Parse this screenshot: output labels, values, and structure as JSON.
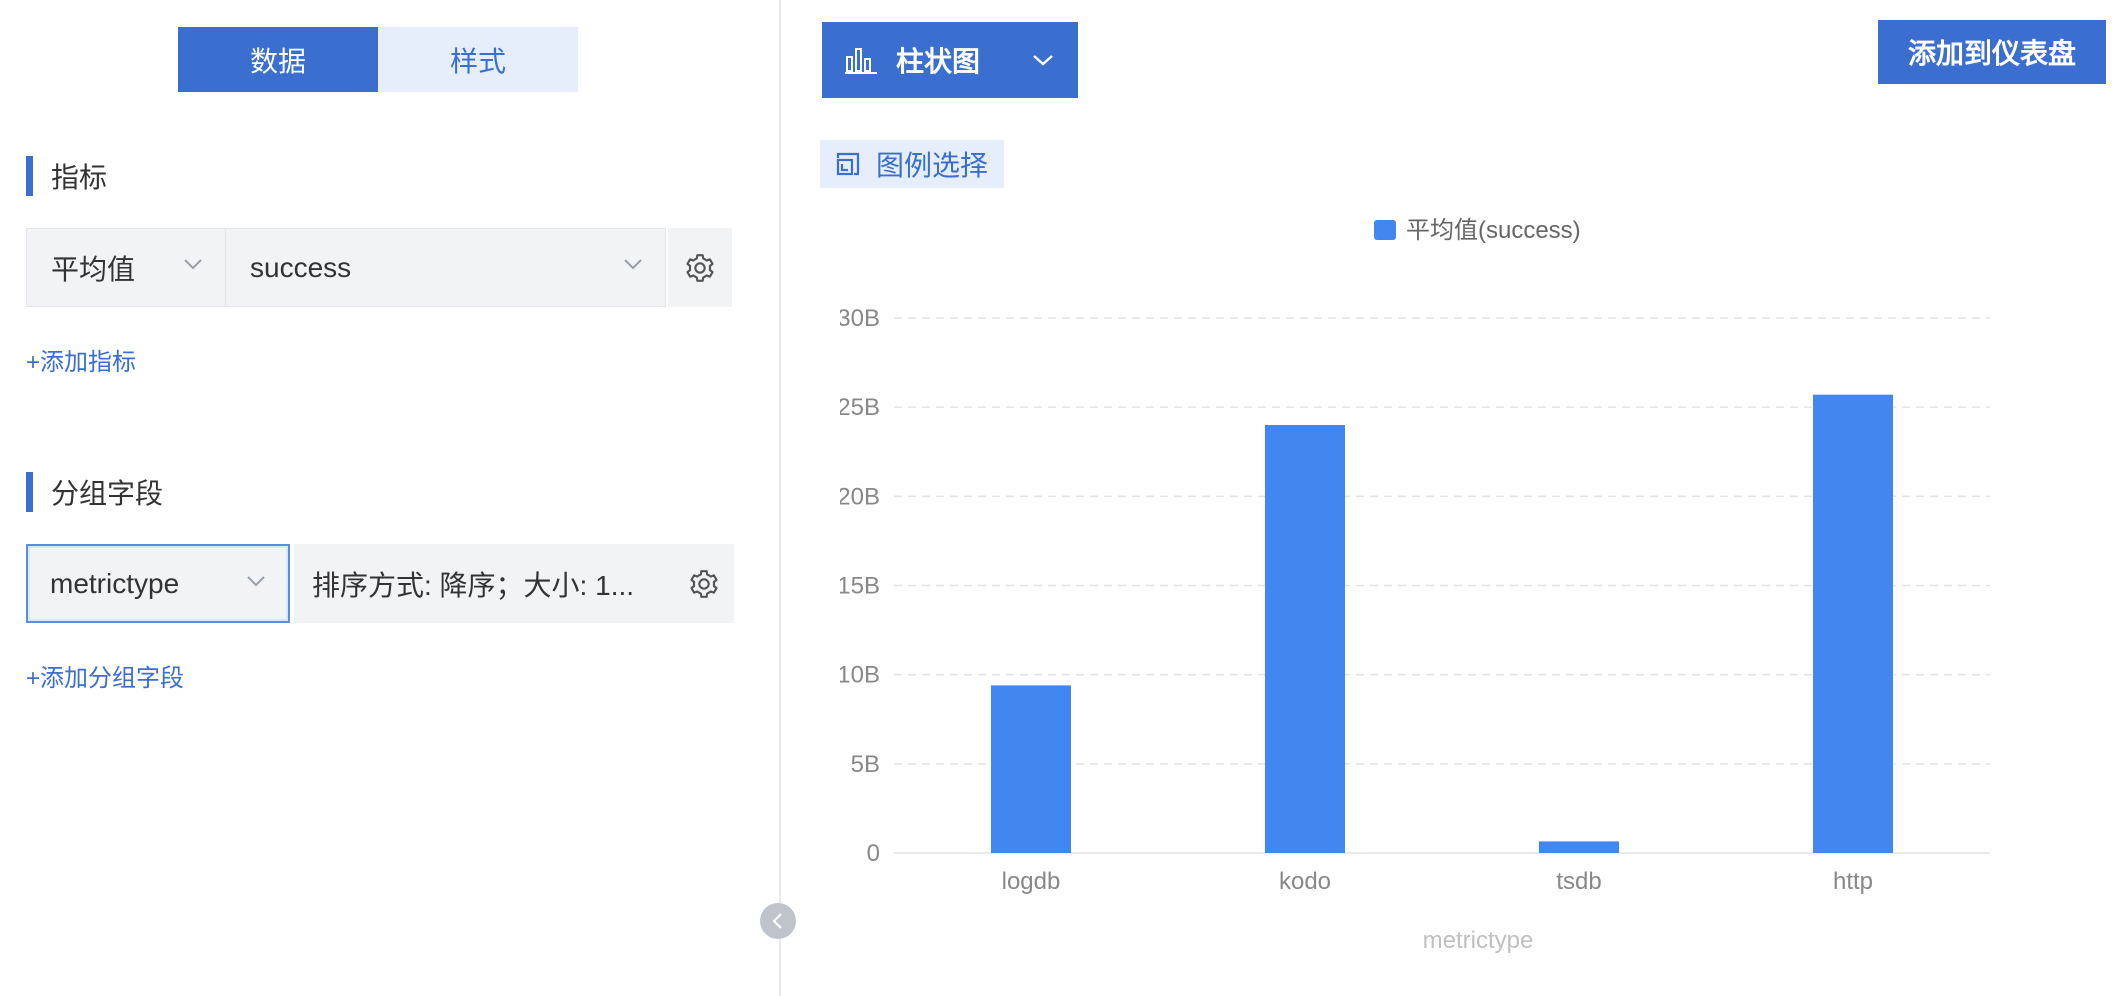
{
  "tabs": [
    {
      "label": "数据",
      "active": true
    },
    {
      "label": "样式",
      "active": false
    }
  ],
  "metrics": {
    "title": "指标",
    "aggregation": "平均值",
    "field": "success",
    "add_label": "+添加指标"
  },
  "grouping": {
    "title": "分组字段",
    "field": "metrictype",
    "sort_summary": "排序方式: 降序；大小: 1...",
    "add_label": "+添加分组字段"
  },
  "toolbar": {
    "chart_type_label": "柱状图",
    "add_dashboard_label": "添加到仪表盘",
    "legend_select_label": "图例选择"
  },
  "colors": {
    "accent": "#3a6fd0",
    "bar": "#4287ef",
    "light_accent_bg": "#e6eefb"
  },
  "chart_data": {
    "type": "bar",
    "categories": [
      "logdb",
      "kodo",
      "tsdb",
      "http"
    ],
    "series": [
      {
        "name": "平均值(success)",
        "values": [
          9.4,
          24.0,
          0.65,
          25.7
        ]
      }
    ],
    "ylim": [
      0,
      30
    ],
    "yticks": [
      {
        "value": 0,
        "label": "0"
      },
      {
        "value": 5,
        "label": "5B"
      },
      {
        "value": 10,
        "label": "10B"
      },
      {
        "value": 15,
        "label": "15B"
      },
      {
        "value": 20,
        "label": "20B"
      },
      {
        "value": 25,
        "label": "25B"
      },
      {
        "value": 30,
        "label": "30B"
      }
    ],
    "xlabel": "metrictype",
    "ylabel": "",
    "grid": true,
    "legend_position": "top-center"
  }
}
